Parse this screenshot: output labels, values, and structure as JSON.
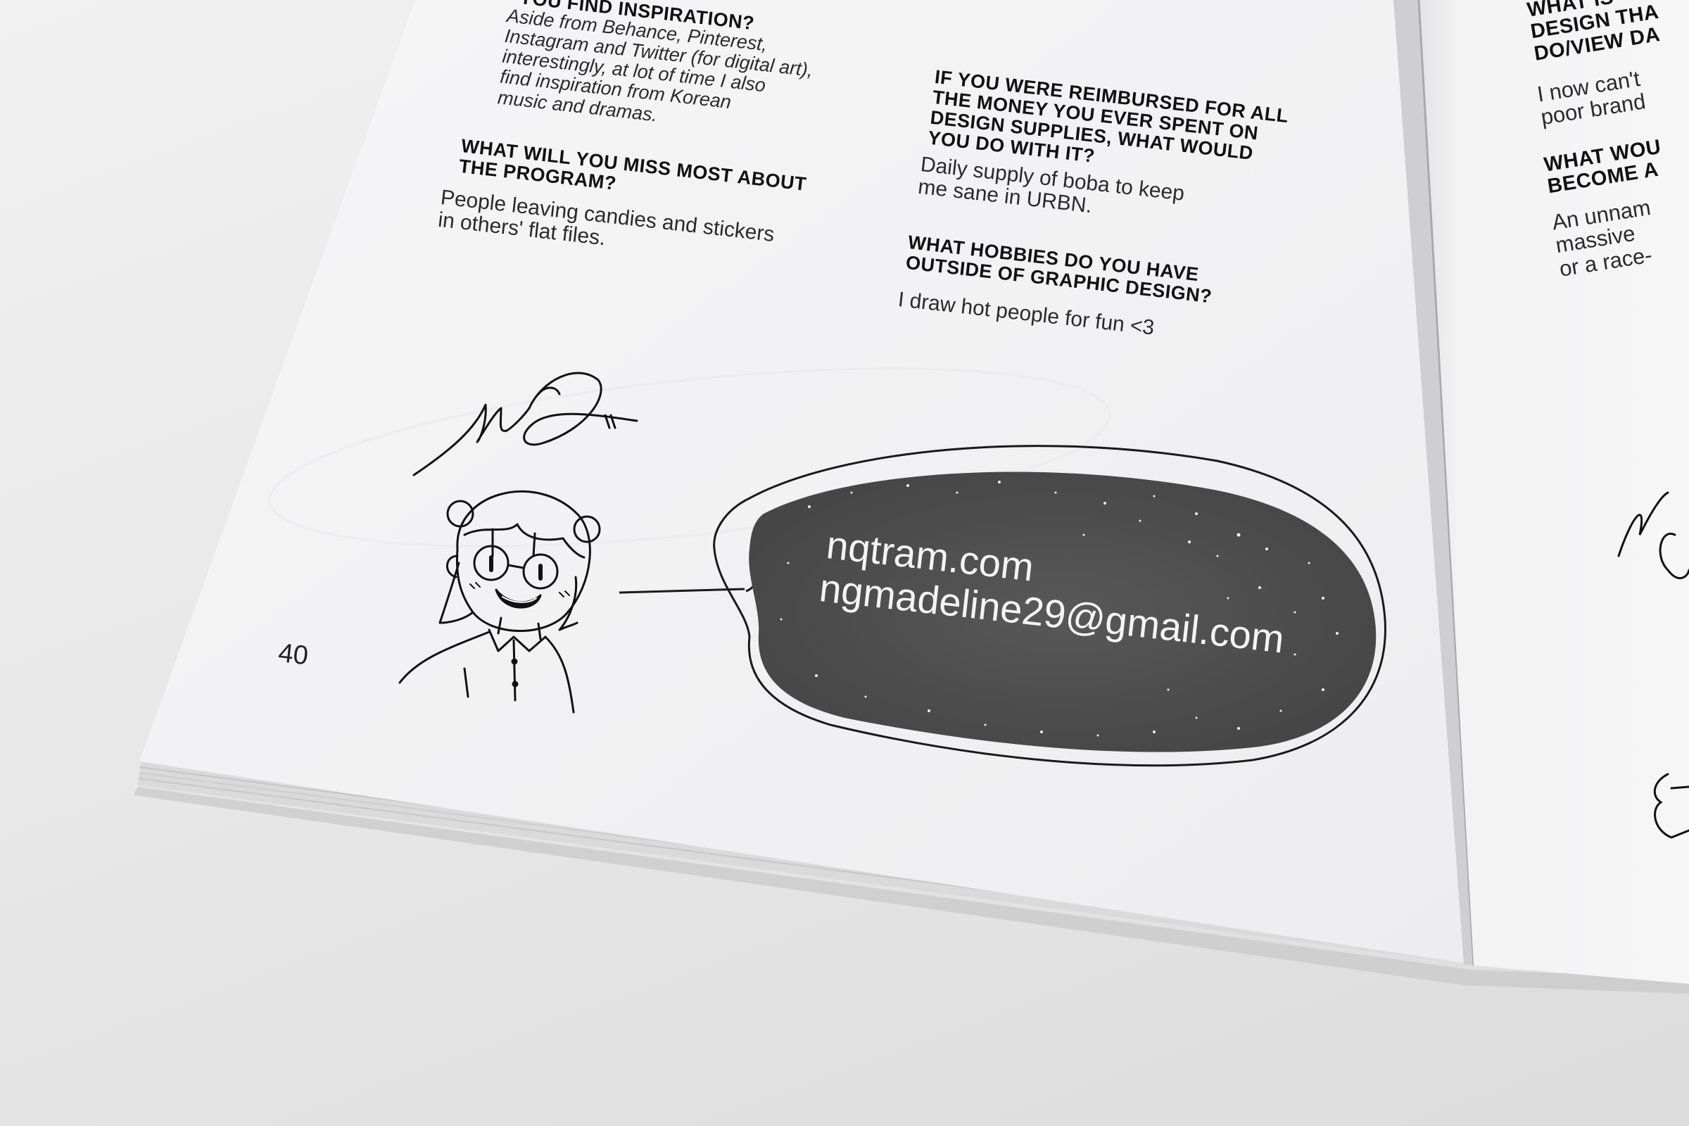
{
  "left_page": {
    "col1": {
      "q_top": "YOU FIND INSPIRATION?",
      "a_top": "Aside from Behance, Pinterest,\nInstagram and Twitter (for digital art),\ninterestingly, at lot of time I also\nfind inspiration from Korean\nmusic and dramas.",
      "q_miss": "WHAT WILL YOU MISS MOST ABOUT\nTHE PROGRAM?",
      "a_miss": "People leaving candies and stickers\nin others' flat files."
    },
    "col2": {
      "q_reimb": "IF YOU WERE REIMBURSED FOR ALL\nTHE MONEY YOU EVER SPENT ON\nDESIGN SUPPLIES, WHAT WOULD\nYOU DO WITH IT?",
      "a_reimb": "Daily supply of boba to keep\nme sane in URBN.",
      "q_hobby": "WHAT HOBBIES DO YOU HAVE\nOUTSIDE OF GRAPHIC DESIGN?",
      "a_hobby": "I draw hot people for fun <3"
    },
    "page_number": "40",
    "contact": {
      "website": "nqtram.com",
      "email": "ngmadeline29@gmail.com"
    }
  },
  "right_page": {
    "q1": "WHAT IS\nDESIGN THA\nDO/VIEW DA",
    "a1": "I now can't\npoor brand",
    "q2": "WHAT WOU\nBECOME A",
    "a2": "An unnam\nmassive\nor a race-"
  },
  "colors": {
    "paper": "#f5f5f6",
    "ink": "#1a1a1a",
    "bubble": "#505050",
    "bubble_text": "#f4f4f4"
  },
  "icons": [
    "signature-icon",
    "character-illustration-icon",
    "speech-bubble-icon"
  ]
}
